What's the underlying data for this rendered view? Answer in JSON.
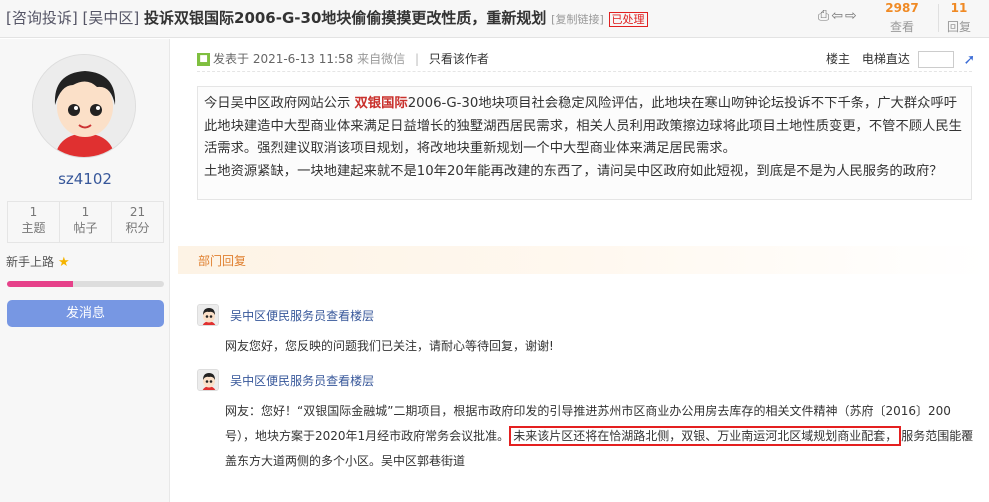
{
  "header": {
    "category1": "[咨询投诉]",
    "category2": "[吴中区]",
    "title": "投诉双银国际2006-G-30地块偷偷摸摸更改性质，重新规划",
    "copy_link": "[复制链接]",
    "status": "已处理",
    "views": "2987",
    "views_label": "查看",
    "replies": "11",
    "replies_label": "回复"
  },
  "author": {
    "name": "sz4102",
    "stats": [
      {
        "value": "1",
        "label": "主题"
      },
      {
        "value": "1",
        "label": "帖子"
      },
      {
        "value": "21",
        "label": "积分"
      }
    ],
    "rank": "新手上路",
    "progress": 0.42,
    "message_button": "发消息"
  },
  "post_meta": {
    "posted": "发表于 2021-6-13 11:58",
    "source": "来自微信",
    "only_author": "只看该作者",
    "floor": "楼主",
    "elevator": "电梯直达"
  },
  "post": {
    "p1_before": "今日吴中区政府网站公示 ",
    "p1_highlight": "双银国际",
    "p1_after": "2006-G-30地块项目社会稳定风险评估，此地块在寒山吻钟论坛投诉不下千条，广大群众呼吁此地块建造中大型商业体来满足日益增长的独墅湖西居民需求，相关人员利用政策擦边球将此项目土地性质变更，不管不顾人民生活需求。强烈建议取消该项目规划，将改地块重新规划一个中大型商业体来满足居民需求。",
    "p2": "土地资源紧缺，一块地建起来就不是10年20年能再改建的东西了，请问吴中区政府如此短视，到底是不是为人民服务的政府？"
  },
  "dept_reply_label": "部门回复",
  "replies": [
    {
      "name": "吴中区便民服务员查看楼层",
      "text": "网友您好，您反映的问题我们已关注，请耐心等待回复，谢谢!"
    },
    {
      "name": "吴中区便民服务员查看楼层",
      "text_before": "网友：您好！“双银国际金融城”二期项目，根据市政府印发的引导推进苏州市区商业办公用房去库存的相关文件精神（苏府〔2016〕200号），地块方案于2020年1月经市政府常务会议批准。",
      "text_boxed": "未来该片区还将在恰湖路北侧，双银、万业南运河北区域规划商业配套，",
      "text_after": "服务范围能覆盖东方大道两侧的多个小区。吴中区郭巷街道"
    }
  ],
  "colors": {
    "accent_orange": "#f08a24",
    "link_blue": "#37579a",
    "highlight_red": "#c9302c",
    "button_blue": "#7797e3"
  },
  "icons": [
    "print-icon",
    "prev-icon",
    "next-icon",
    "post-icon",
    "star-icon",
    "jump-icon"
  ]
}
